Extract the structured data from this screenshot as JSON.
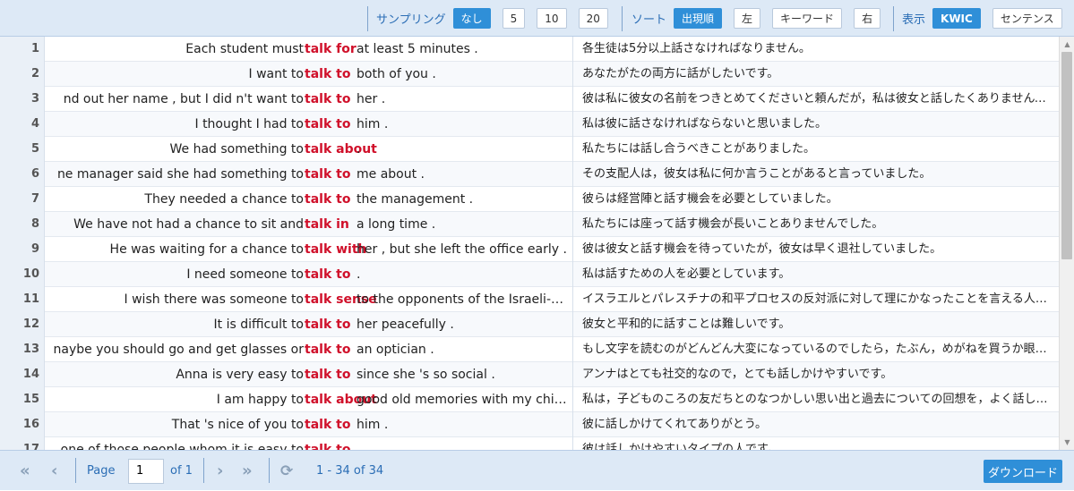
{
  "toolbar": {
    "sampling_label": "サンプリング",
    "sampling_options": [
      "なし",
      "5",
      "10",
      "20"
    ],
    "sort_label": "ソート",
    "sort_options": [
      "出現順",
      "左",
      "キーワード",
      "右"
    ],
    "display_label": "表示",
    "display_options": [
      "KWIC",
      "センテンス"
    ]
  },
  "rows": [
    {
      "n": "1",
      "left": "Each student must",
      "kw": "talk for",
      "right": "at least 5 minutes .",
      "trans": "各生徒は5分以上話さなければなりません。"
    },
    {
      "n": "2",
      "left": "I want to",
      "kw": "talk to",
      "right": "both of you .",
      "trans": "あなたがたの両方に話がしたいです。"
    },
    {
      "n": "3",
      "left": "nd out her name , but I did n't want to",
      "kw": "talk to",
      "right": "her .",
      "trans": "彼は私に彼女の名前をつきとめてくださいと頼んだが，私は彼女と話したくありませんでした。"
    },
    {
      "n": "4",
      "left": "I thought I had to",
      "kw": "talk to",
      "right": "him .",
      "trans": "私は彼に話さなければならないと思いました。"
    },
    {
      "n": "5",
      "left": "We had something to",
      "kw": "talk about",
      "right": ".",
      "trans": "私たちには話し合うべきことがありました。"
    },
    {
      "n": "6",
      "left": "ne manager said she had something to",
      "kw": "talk to",
      "right": "me about .",
      "trans": "その支配人は，彼女は私に何か言うことがあると言っていました。"
    },
    {
      "n": "7",
      "left": "They needed a chance to",
      "kw": "talk to",
      "right": "the management .",
      "trans": "彼らは経営陣と話す機会を必要としていました。"
    },
    {
      "n": "8",
      "left": "We have not had a chance to sit and",
      "kw": "talk in",
      "right": "a long time .",
      "trans": "私たちには座って話す機会が長いことありませんでした。"
    },
    {
      "n": "9",
      "left": "He was waiting for a chance to",
      "kw": "talk with",
      "right": "her , but she left the office early .",
      "trans": "彼は彼女と話す機会を待っていたが，彼女は早く退社していました。"
    },
    {
      "n": "10",
      "left": "I need someone to",
      "kw": "talk to",
      "right": ".",
      "trans": "私は話すための人を必要としています。"
    },
    {
      "n": "11",
      "left": "I wish there was someone to",
      "kw": "talk sense",
      "right": "to the opponents of the Israeli-Palestinian peace process .",
      "trans": "イスラエルとパレスチナの和平プロセスの反対派に対して理にかなったことを言える人がいればいいのに。"
    },
    {
      "n": "12",
      "left": "It is difficult to",
      "kw": "talk to",
      "right": "her peacefully .",
      "trans": "彼女と平和的に話すことは難しいです。"
    },
    {
      "n": "13",
      "left": "naybe you should go and get glasses or",
      "kw": "talk to",
      "right": "an optician .",
      "trans": "もし文字を読むのがどんどん大変になっているのでしたら，たぶん，めがねを買うか眼鏡屋に相談すべきです。"
    },
    {
      "n": "14",
      "left": "Anna is very easy to",
      "kw": "talk to",
      "right": "since she 's so social .",
      "trans": "アンナはとても社交的なので，とても話しかけやすいです。"
    },
    {
      "n": "15",
      "left": "I am happy to",
      "kw": "talk about",
      "right": "good old memories with my childhood friends .",
      "trans": "私は，子どものころの友だちとのなつかしい思い出と過去についての回想を，よく話します。"
    },
    {
      "n": "16",
      "left": "That 's nice of you to",
      "kw": "talk to",
      "right": "him .",
      "trans": "彼に話しかけてくれてありがとう。"
    },
    {
      "n": "17",
      "left": "one of those people whom it is easy to",
      "kw": "talk to",
      "right": ".",
      "trans": "彼は話しかけやすいタイプの人です。"
    }
  ],
  "footer": {
    "page_label": "Page",
    "page_value": "1",
    "of_label": "of 1",
    "range_text": "1 - 34 of 34",
    "download_label": "ダウンロード"
  },
  "colors": {
    "accent": "#2f8fd8",
    "keyword": "#d0102a",
    "toolbar_bg": "#dde9f6"
  }
}
